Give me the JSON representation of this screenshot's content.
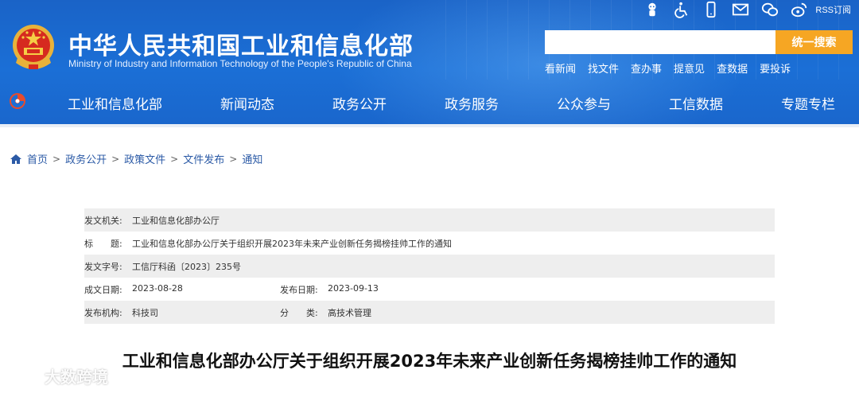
{
  "header": {
    "site_title": "中华人民共和国工业和信息化部",
    "site_subtitle": "Ministry of Industry and Information Technology of the People's Republic of China",
    "rss_label": "RSS订阅",
    "util_icons": [
      "robot-icon",
      "accessibility-icon",
      "mobile-icon",
      "mail-icon",
      "wechat-icon",
      "weibo-icon"
    ],
    "search": {
      "placeholder": "",
      "button_label": "统一搜索"
    },
    "quick_links": [
      "看新闻",
      "找文件",
      "查办事",
      "提意见",
      "查数据",
      "要投诉"
    ],
    "nav": [
      "工业和信息化部",
      "新闻动态",
      "政务公开",
      "政务服务",
      "公众参与",
      "工信数据",
      "专题专栏"
    ]
  },
  "breadcrumb": [
    "首页",
    "政务公开",
    "政策文件",
    "文件发布",
    "通知"
  ],
  "info": {
    "issuer_label": "发文机关:",
    "issuer": "工业和信息化部办公厅",
    "title_label": "标　　题:",
    "title": "工业和信息化部办公厅关于组织开展2023年未来产业创新任务揭榜挂帅工作的通知",
    "doc_no_label": "发文字号:",
    "doc_no": "工信厅科函〔2023〕235号",
    "created_label": "成文日期:",
    "created": "2023-08-28",
    "published_label": "发布日期:",
    "published": "2023-09-13",
    "org_label": "发布机构:",
    "org": "科技司",
    "category_label": "分　　类:",
    "category": "高技术管理"
  },
  "document_title": "工业和信息化部办公厅关于组织开展2023年未来产业创新任务揭榜挂帅工作的通知",
  "watermark": "大数跨境",
  "colors": {
    "header_blue": "#1b6fd6",
    "search_orange": "#f6a623",
    "link_blue": "#2b5aa6"
  }
}
